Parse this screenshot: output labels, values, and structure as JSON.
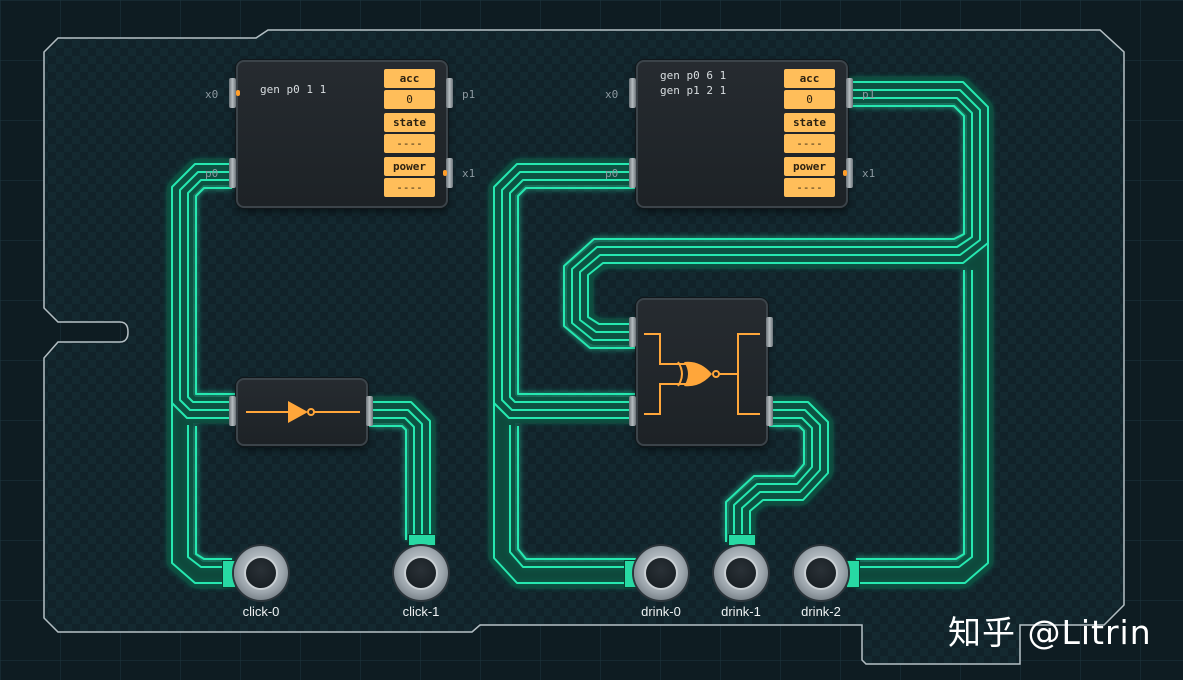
{
  "chips": [
    {
      "code": "gen p0 1 1",
      "ports": {
        "x0": "x0",
        "p0": "p0",
        "p1": "p1",
        "x1": "x1"
      },
      "registers": [
        {
          "label": "acc",
          "value": "0"
        },
        {
          "label": "state",
          "value": "----"
        },
        {
          "label": "power",
          "value": "----"
        }
      ]
    },
    {
      "code": "gen p0 6 1\ngen p1 2 1",
      "ports": {
        "x0": "x0",
        "p0": "p0",
        "p1": "p1",
        "x1": "x1"
      },
      "registers": [
        {
          "label": "acc",
          "value": "0"
        },
        {
          "label": "state",
          "value": "----"
        },
        {
          "label": "power",
          "value": "----"
        }
      ]
    }
  ],
  "gates": {
    "not": "not-gate-icon",
    "xor": "xor-gate-icon"
  },
  "buttons": [
    "click-0",
    "click-1",
    "drink-0",
    "drink-1",
    "drink-2"
  ],
  "watermark": "知乎 @Litrin",
  "colors": {
    "wire": "#27e8b0",
    "register": "#ffbe5a",
    "board": "#13262c",
    "background": "#0e1c22"
  }
}
